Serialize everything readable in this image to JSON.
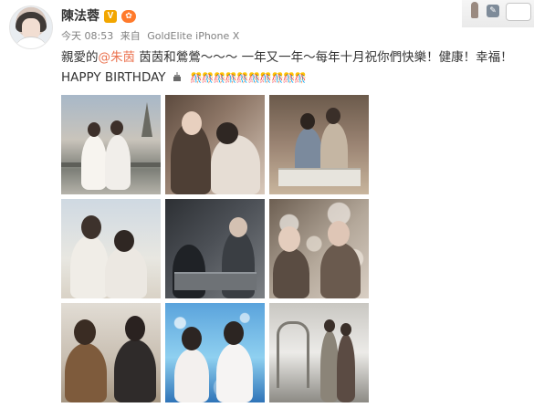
{
  "post": {
    "username": "陳法蓉",
    "vip_badge": "V",
    "member_badge": "✿",
    "timestamp": "今天 08:53",
    "source_prefix": "来自",
    "source": "GoldElite iPhone X",
    "text_before_mention": "親愛的",
    "mention": "@朱茵",
    "text_after_mention": " 茵茵和鶯鶯～～～ 一年又一年～每年十月祝你們快樂！健康！幸福！HAPPY BIRTHDAY",
    "decoration_icons": "🎊🎊🎊🎊🎊🎊🎊🎊🎊🎊"
  },
  "icons": {
    "avatar": "avatar-icon",
    "cake": "birthday-cake-icon",
    "decoration": "confetti-icon"
  },
  "colors": {
    "mention": "#eb7350",
    "text": "#333333",
    "meta": "#808080",
    "vip_badge": "#f2a600",
    "member_badge": "#ff7a2b"
  },
  "photos": [
    {
      "id": "photo-1"
    },
    {
      "id": "photo-2"
    },
    {
      "id": "photo-3"
    },
    {
      "id": "photo-4"
    },
    {
      "id": "photo-5"
    },
    {
      "id": "photo-6"
    },
    {
      "id": "photo-7"
    },
    {
      "id": "photo-8"
    },
    {
      "id": "photo-9"
    }
  ]
}
